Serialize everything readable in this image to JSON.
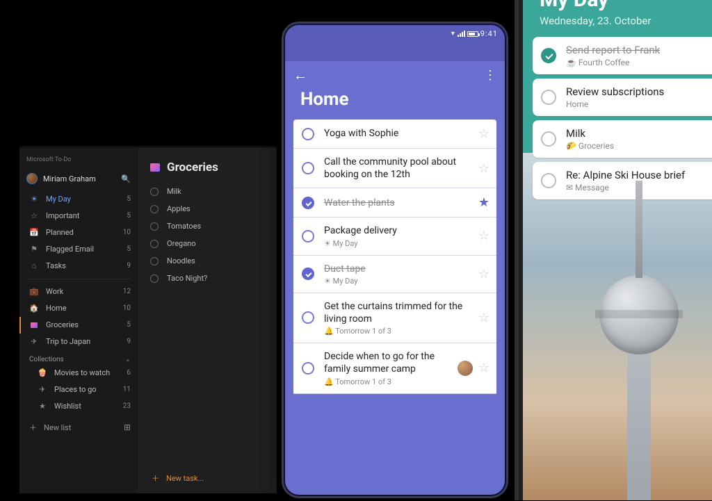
{
  "desktop": {
    "app_title": "Microsoft To-Do",
    "user_name": "Miriam Graham",
    "nav": [
      {
        "icon": "☀",
        "label": "My Day",
        "count": 5,
        "active": true
      },
      {
        "icon": "☆",
        "label": "Important",
        "count": 5
      },
      {
        "icon": "📅",
        "label": "Planned",
        "count": 10
      },
      {
        "icon": "⚑",
        "label": "Flagged Email",
        "count": 5
      },
      {
        "icon": "⌂",
        "label": "Tasks",
        "count": 9
      }
    ],
    "lists": [
      {
        "icon": "💼",
        "label": "Work",
        "count": 12
      },
      {
        "icon": "🏠",
        "label": "Home",
        "count": 10
      },
      {
        "icon": "▮",
        "label": "Groceries",
        "count": 5,
        "selected": true
      },
      {
        "icon": "✈",
        "label": "Trip to Japan",
        "count": 9
      }
    ],
    "collections_label": "Collections",
    "collections": [
      {
        "icon": "🍿",
        "label": "Movies to watch",
        "count": 6
      },
      {
        "icon": "✈",
        "label": "Places to go",
        "count": 11
      },
      {
        "icon": "★",
        "label": "Wishlist",
        "count": 23
      }
    ],
    "new_list_label": "New list",
    "main": {
      "list_title": "Groceries",
      "tasks": [
        {
          "label": "Milk"
        },
        {
          "label": "Apples"
        },
        {
          "label": "Tomatoes"
        },
        {
          "label": "Oregano"
        },
        {
          "label": "Noodles"
        },
        {
          "label": "Taco Night?"
        }
      ],
      "new_task_label": "New task..."
    }
  },
  "android": {
    "time": "9:41",
    "title": "Home",
    "tasks": [
      {
        "title": "Yoga with Sophie",
        "done": false,
        "star": false
      },
      {
        "title": "Call the community pool about booking on the 12th",
        "done": false,
        "star": false
      },
      {
        "title": "Water the plants",
        "done": true,
        "star": true
      },
      {
        "title": "Package delivery",
        "done": false,
        "sub": "☀ My Day",
        "star": false
      },
      {
        "title": "Duct tape",
        "done": true,
        "sub": "☀ My Day",
        "star": false
      },
      {
        "title": "Get the curtains trimmed for the living room",
        "done": false,
        "sub": "🔔 Tomorrow  1 of 3",
        "star": false
      },
      {
        "title": "Decide when to go for the family summer camp",
        "done": false,
        "sub": "🔔 Tomorrow  1 of 3",
        "star": false,
        "avatar": true
      }
    ]
  },
  "ios": {
    "title": "My Day",
    "date": "Wednesday, 23. October",
    "cards": [
      {
        "title": "Send report to Frank",
        "done": true,
        "sub": "☕ Fourth Coffee"
      },
      {
        "title": "Review subscriptions",
        "done": false,
        "sub": "Home"
      },
      {
        "title": "Milk",
        "done": false,
        "sub": "🌮 Groceries"
      },
      {
        "title": "Re: Alpine Ski House brief",
        "done": false,
        "sub": "✉ Message"
      }
    ]
  }
}
